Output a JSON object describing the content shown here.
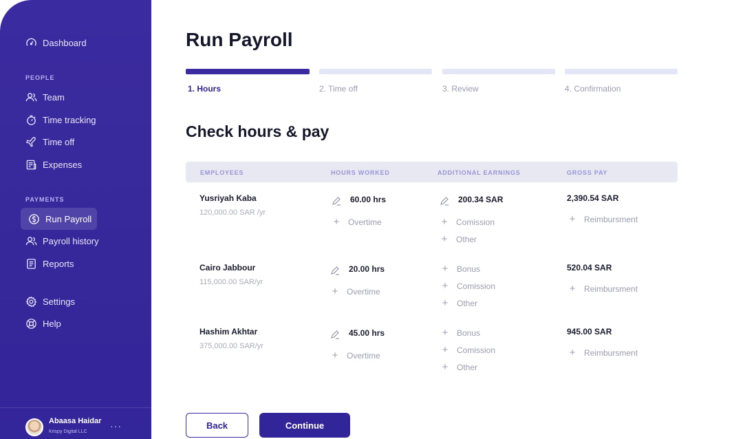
{
  "sidebar": {
    "dashboard": "Dashboard",
    "people_label": "PEOPLE",
    "team": "Team",
    "time_tracking": "Time tracking",
    "time_off": "Time off",
    "expenses": "Expenses",
    "payments_label": "PAYMENTS",
    "run_payroll": "Run Payroll",
    "payroll_history": "Payroll history",
    "reports": "Reports",
    "settings": "Settings",
    "help": "Help",
    "user_name": "Abaasa Haidar",
    "user_company": "Krispy Digital LLC",
    "more": "···"
  },
  "page": {
    "title": "Run Payroll",
    "steps": [
      "1. Hours",
      "2. Time off",
      "3. Review",
      "4. Confirmation"
    ],
    "active_step": 1,
    "section_title": "Check hours & pay"
  },
  "table": {
    "headers": [
      "EMPLOYEES",
      "HOURS WORKED",
      "ADDITIONAL EARNINGS",
      "GROSS PAY"
    ],
    "rows": [
      {
        "name": "Yusriyah Kaba",
        "salary": "120,000.00 SAR /yr",
        "hours": "60.00 hrs",
        "hours_extra": "Overtime",
        "earnings_value": "200.34 SAR",
        "earnings_items": [
          "Comission",
          "Other"
        ],
        "gross": "2,390.54 SAR",
        "gross_extra": "Reimbursment"
      },
      {
        "name": "Cairo Jabbour",
        "salary": "115,000.00 SAR/yr",
        "hours": "20.00 hrs",
        "hours_extra": "Overtime",
        "earnings_items": [
          "Bonus",
          "Comission",
          "Other"
        ],
        "gross": "520.04 SAR",
        "gross_extra": "Reimbursment"
      },
      {
        "name": "Hashim Akhtar",
        "salary": "375,000.00 SAR/yr",
        "hours": "45.00 hrs",
        "hours_extra": "Overtime",
        "earnings_items": [
          "Bonus",
          "Comission",
          "Other"
        ],
        "gross": "945.00 SAR",
        "gross_extra": "Reimbursment"
      }
    ]
  },
  "actions": {
    "back": "Back",
    "continue": "Continue"
  },
  "colors": {
    "brand": "#3b2ba0",
    "step_inactive": "#e3e6f7",
    "table_head": "#e8e8f3"
  }
}
